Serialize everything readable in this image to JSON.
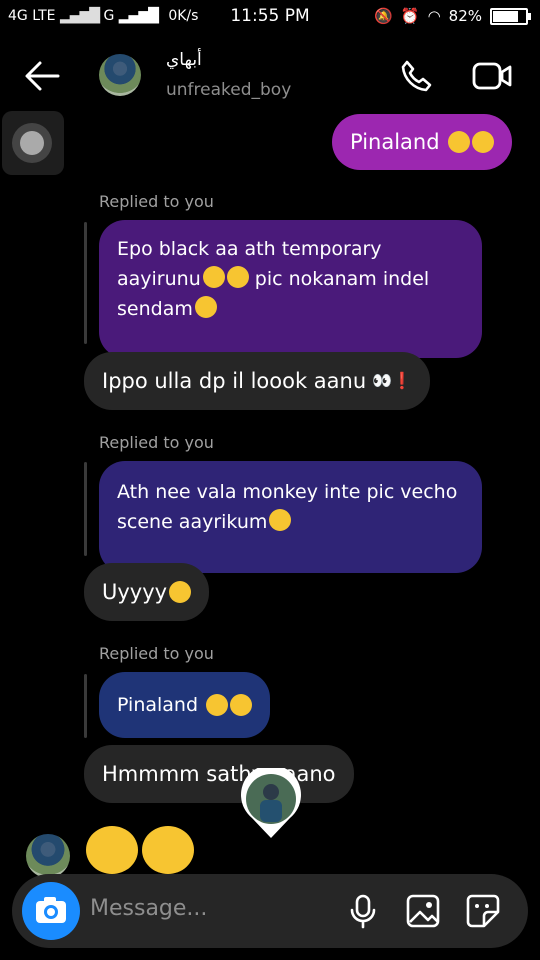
{
  "status": {
    "network": "4G LTE",
    "network2": "G",
    "speed": "0K/s",
    "time": "11:55 PM",
    "battery": "82%",
    "battery_level": 0.82
  },
  "header": {
    "name": "أبهاي",
    "username": "unfreaked_boy"
  },
  "messages": [
    {
      "type": "sent",
      "text": "Pinaland",
      "emojis": 2
    },
    {
      "type": "replied-label",
      "text": "Replied to you"
    },
    {
      "type": "quoted",
      "lines": [
        "Epo black aa ath temporary",
        "aayirunu",
        "pic nokanam indel",
        "sendam"
      ]
    },
    {
      "type": "received",
      "text": "Ippo ulla dp il loook aanu",
      "tail": "👀❗"
    },
    {
      "type": "replied-label",
      "text": "Replied to you"
    },
    {
      "type": "quoted",
      "lines": [
        "Ath nee vala monkey inte pic vecho",
        "scene aayrikum"
      ]
    },
    {
      "type": "received",
      "text": "Uyyyy"
    },
    {
      "type": "replied-label",
      "text": "Replied to you"
    },
    {
      "type": "quoted",
      "lines": [
        "Pinaland"
      ]
    },
    {
      "type": "received",
      "text": "Hmmmm sathya aano"
    }
  ],
  "composer": {
    "placeholder": "Message..."
  },
  "colors": {
    "sent": "#7b1fa2",
    "quote1": "#4a1a7a",
    "quote2": "#2f2476",
    "quote3": "#1f3477",
    "received": "#262626",
    "accent": "#1a8cff"
  }
}
